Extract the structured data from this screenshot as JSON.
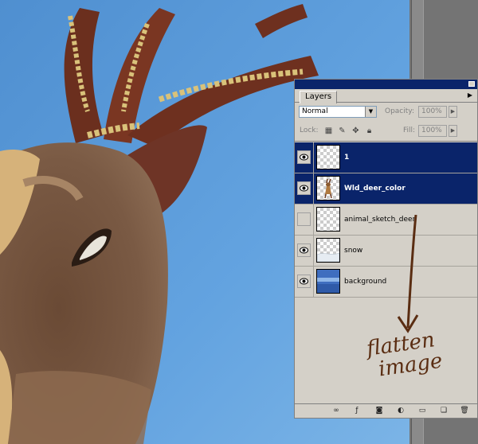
{
  "panel": {
    "tab_label": "Layers",
    "blend_mode": "Normal",
    "opacity_label": "Opacity:",
    "opacity_value": "100%",
    "lock_label": "Lock:",
    "fill_label": "Fill:",
    "fill_value": "100%"
  },
  "layers": [
    {
      "name": "1",
      "visible": true,
      "selected": true,
      "thumb": "transparent"
    },
    {
      "name": "Wld_deer_color",
      "visible": true,
      "selected": true,
      "thumb": "deer"
    },
    {
      "name": "animal_sketch_deer",
      "visible": false,
      "selected": false,
      "thumb": "transparent"
    },
    {
      "name": "snow",
      "visible": true,
      "selected": false,
      "thumb": "snow"
    },
    {
      "name": "background",
      "visible": true,
      "selected": false,
      "thumb": "background"
    }
  ],
  "annotation": {
    "line1": "flatten",
    "line2": "image",
    "color": "#5a2d12"
  },
  "colors": {
    "selection": "#0a246a",
    "panel": "#d4d0c8",
    "canvas_sky": "#5a9ad8"
  }
}
